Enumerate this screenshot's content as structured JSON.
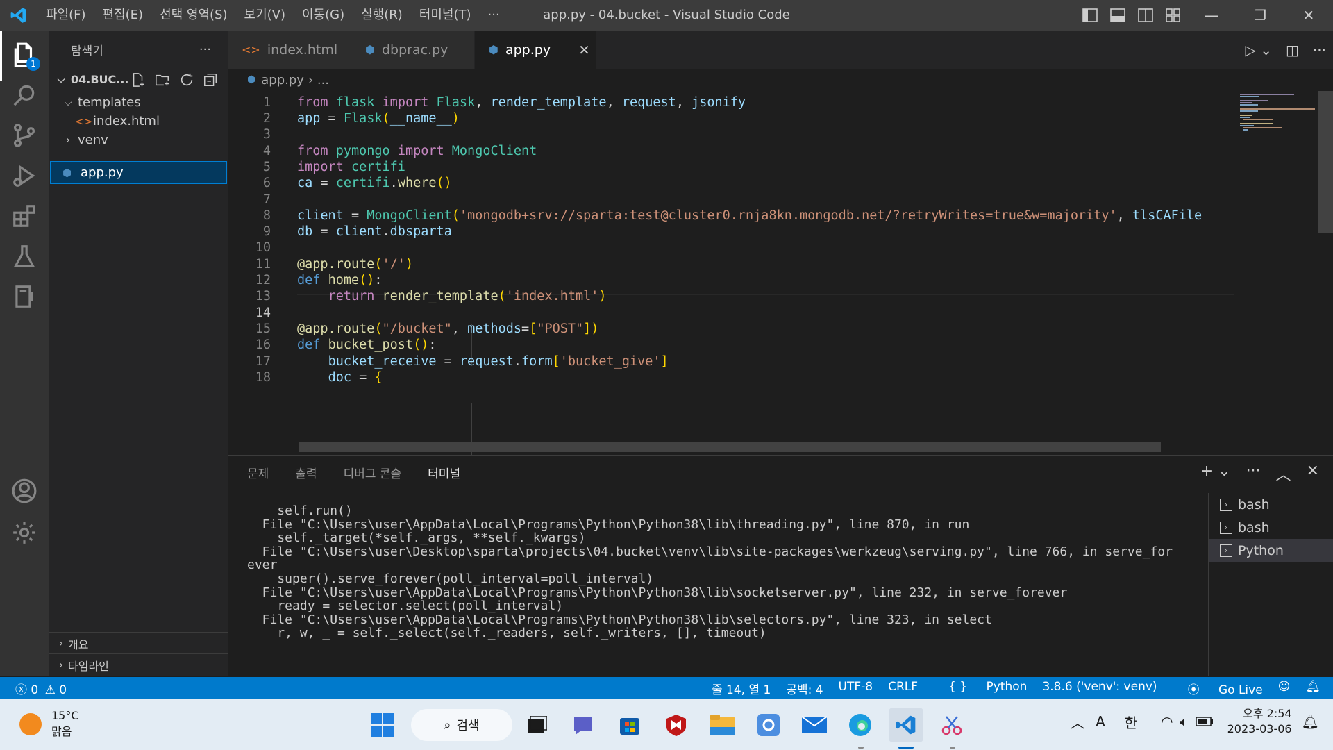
{
  "titlebar": {
    "menu": [
      "파일(F)",
      "편집(E)",
      "선택 영역(S)",
      "보기(V)",
      "이동(G)",
      "실행(R)",
      "터미널(T)",
      "···"
    ],
    "title": "app.py - 04.bucket - Visual Studio Code"
  },
  "activity": {
    "explorer_badge": "1"
  },
  "sidebar": {
    "header": "탐색기",
    "header_more": "···",
    "root": "04.BUC...",
    "items": [
      {
        "label": "templates"
      },
      {
        "label": "index.html"
      },
      {
        "label": "venv"
      },
      {
        "label": "app.py"
      }
    ],
    "outline": "개요",
    "timeline": "타임라인"
  },
  "tabs": [
    {
      "label": "index.html"
    },
    {
      "label": "dbprac.py"
    },
    {
      "label": "app.py"
    }
  ],
  "breadcrumb": {
    "file": "app.py",
    "rest": "›  ..."
  },
  "code": {
    "line_numbers": [
      "1",
      "2",
      "3",
      "4",
      "5",
      "6",
      "7",
      "8",
      "9",
      "10",
      "11",
      "12",
      "13",
      "14",
      "15",
      "16",
      "17",
      "18"
    ],
    "lines": [
      "from flask import Flask, render_template, request, jsonify",
      "app = Flask(__name__)",
      "",
      "from pymongo import MongoClient",
      "import certifi",
      "ca = certifi.where()",
      "",
      "client = MongoClient('mongodb+srv://sparta:test@cluster0.rnja8kn.mongodb.net/?retryWrites=true&w=majority', tlsCAFile",
      "db = client.dbsparta",
      "",
      "@app.route('/')",
      "def home():",
      "    return render_template('index.html')",
      "",
      "@app.route(\"/bucket\", methods=[\"POST\"])",
      "def bucket_post():",
      "    bucket_receive = request.form['bucket_give']",
      "    doc = {"
    ]
  },
  "panel": {
    "tabs": [
      "문제",
      "출력",
      "디버그 콘솔",
      "터미널"
    ],
    "terminal_lines": [
      "    self.run()",
      "  File \"C:\\Users\\user\\AppData\\Local\\Programs\\Python\\Python38\\lib\\threading.py\", line 870, in run",
      "    self._target(*self._args, **self._kwargs)",
      "  File \"C:\\Users\\user\\Desktop\\sparta\\projects\\04.bucket\\venv\\lib\\site-packages\\werkzeug\\serving.py\", line 766, in serve_for",
      "ever",
      "    super().serve_forever(poll_interval=poll_interval)",
      "  File \"C:\\Users\\user\\AppData\\Local\\Programs\\Python\\Python38\\lib\\socketserver.py\", line 232, in serve_forever",
      "    ready = selector.select(poll_interval)",
      "  File \"C:\\Users\\user\\AppData\\Local\\Programs\\Python\\Python38\\lib\\selectors.py\", line 323, in select",
      "    r, w, _ = self._select(self._readers, self._writers, [], timeout)"
    ],
    "terminals": [
      "bash",
      "bash",
      "Python"
    ]
  },
  "statusbar": {
    "errors": "0",
    "warnings": "0",
    "position": "줄 14, 열 1",
    "spaces": "공백: 4",
    "encoding": "UTF-8",
    "eol": "CRLF",
    "language": "Python",
    "interpreter": "3.8.6 ('venv': venv)",
    "golive": "Go Live"
  },
  "taskbar": {
    "temp": "15°C",
    "weather": "맑음",
    "search": "검색",
    "time": "오후 2:54",
    "date": "2023-03-06",
    "ime": "한",
    "ime_mode": "A"
  },
  "colors": {
    "accent": "#007acc",
    "selection": "#04395e"
  }
}
